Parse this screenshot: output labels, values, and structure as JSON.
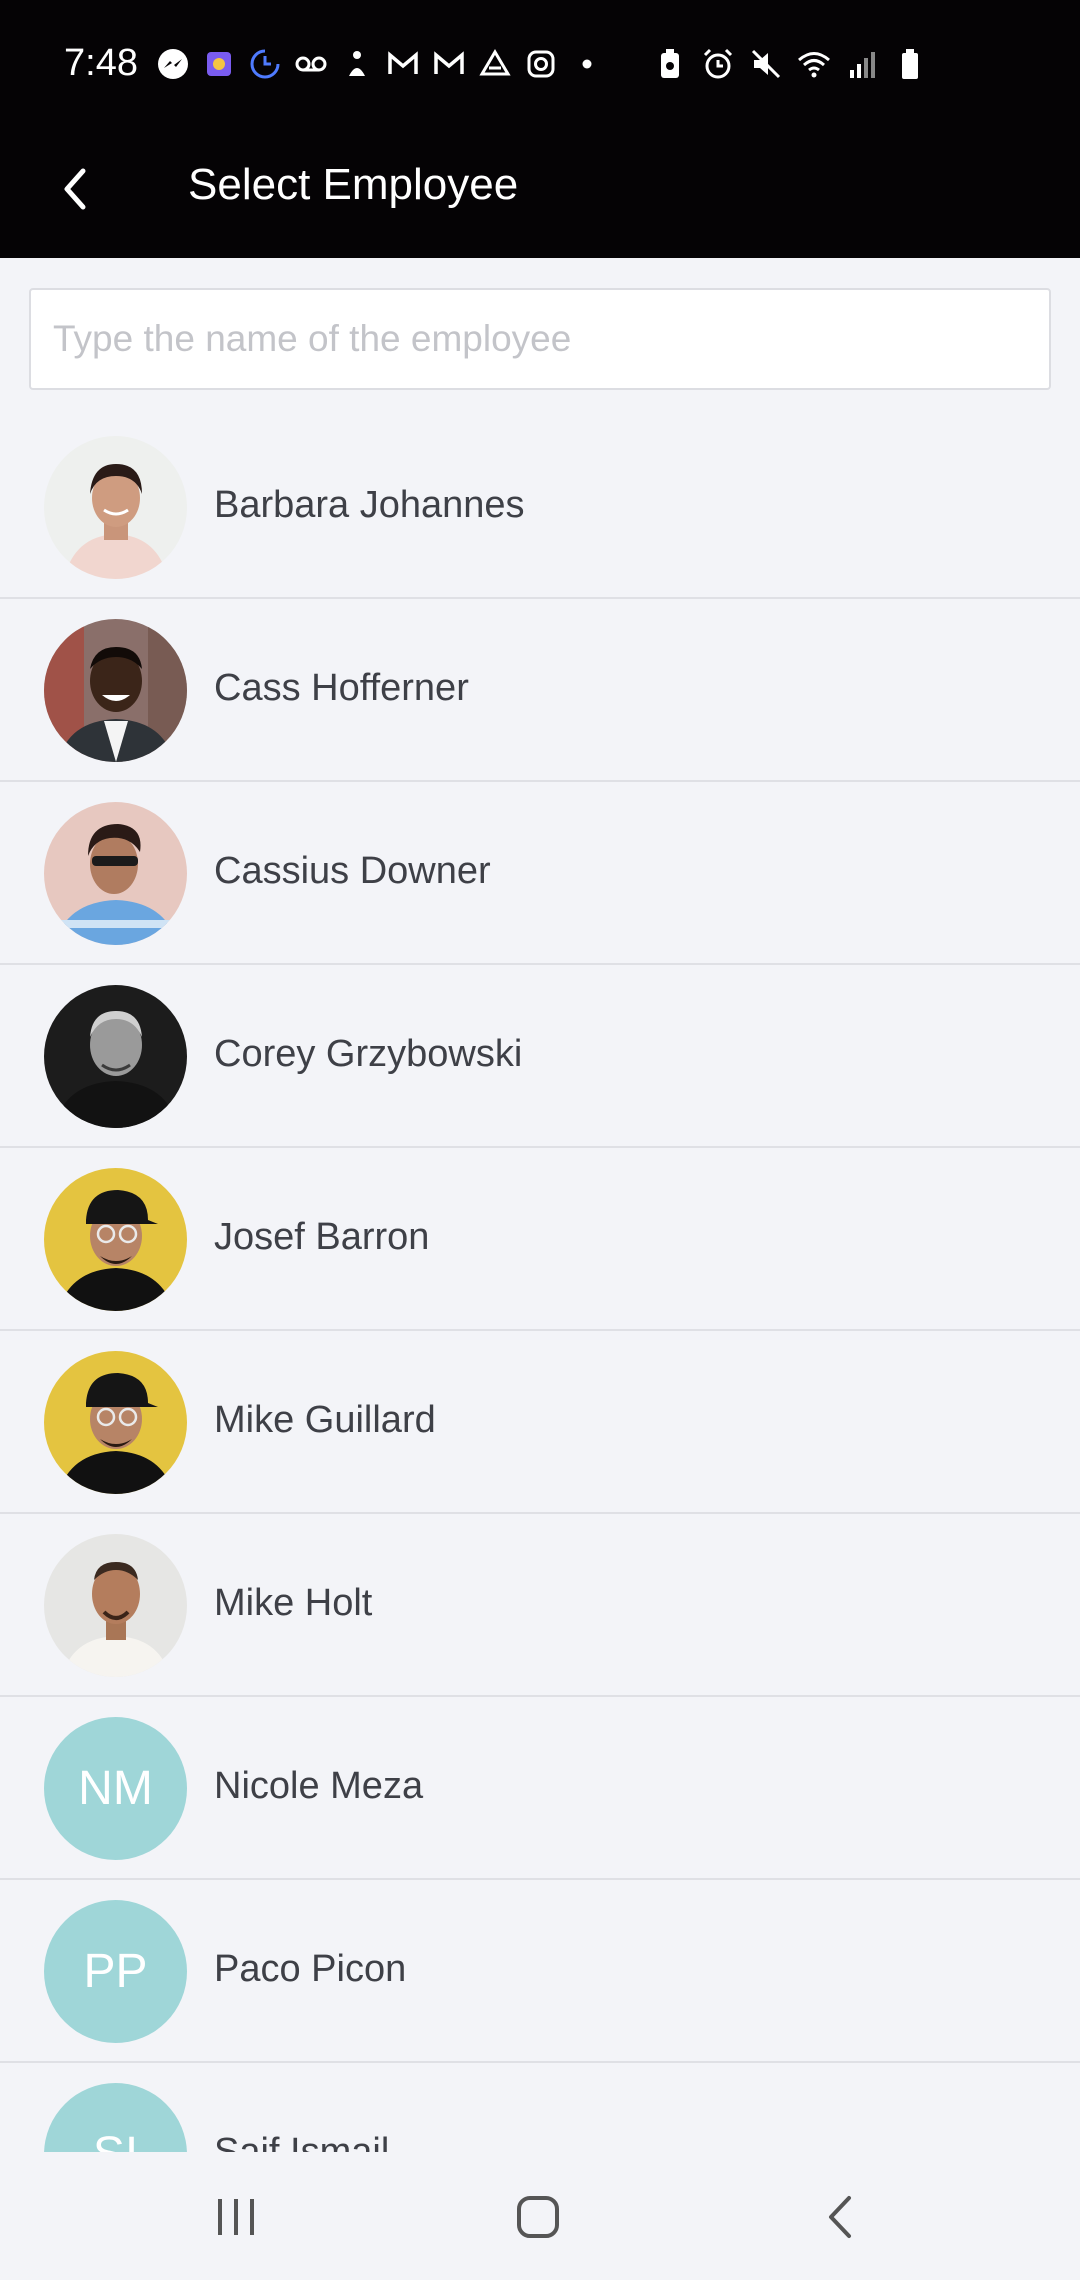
{
  "status_bar": {
    "time": "7:48"
  },
  "header": {
    "title": "Select Employee",
    "back_icon": "chevron-left-icon"
  },
  "search": {
    "placeholder": "Type the name of the employee",
    "value": ""
  },
  "employees": [
    {
      "name": "Barbara Johannes",
      "initials": "",
      "photo": true
    },
    {
      "name": "Cass Hofferner",
      "initials": "",
      "photo": true
    },
    {
      "name": "Cassius Downer",
      "initials": "",
      "photo": true
    },
    {
      "name": "Corey Grzybowski",
      "initials": "",
      "photo": true
    },
    {
      "name": "Josef Barron",
      "initials": "",
      "photo": true
    },
    {
      "name": "Mike Guillard",
      "initials": "",
      "photo": true
    },
    {
      "name": "Mike Holt",
      "initials": "",
      "photo": true
    },
    {
      "name": "Nicole Meza",
      "initials": "NM",
      "photo": false
    },
    {
      "name": "Paco Picon",
      "initials": "PP",
      "photo": false
    },
    {
      "name": "Saif Ismail",
      "initials": "SI",
      "photo": false
    }
  ],
  "colors": {
    "header_bg": "#050305",
    "page_bg": "#f3f4f8",
    "initials_avatar_bg": "#9fd6d8",
    "name_text": "#3e4047"
  },
  "nav_bar": {
    "recents_icon": "recents-icon",
    "home_icon": "home-icon",
    "back_icon": "back-icon"
  }
}
